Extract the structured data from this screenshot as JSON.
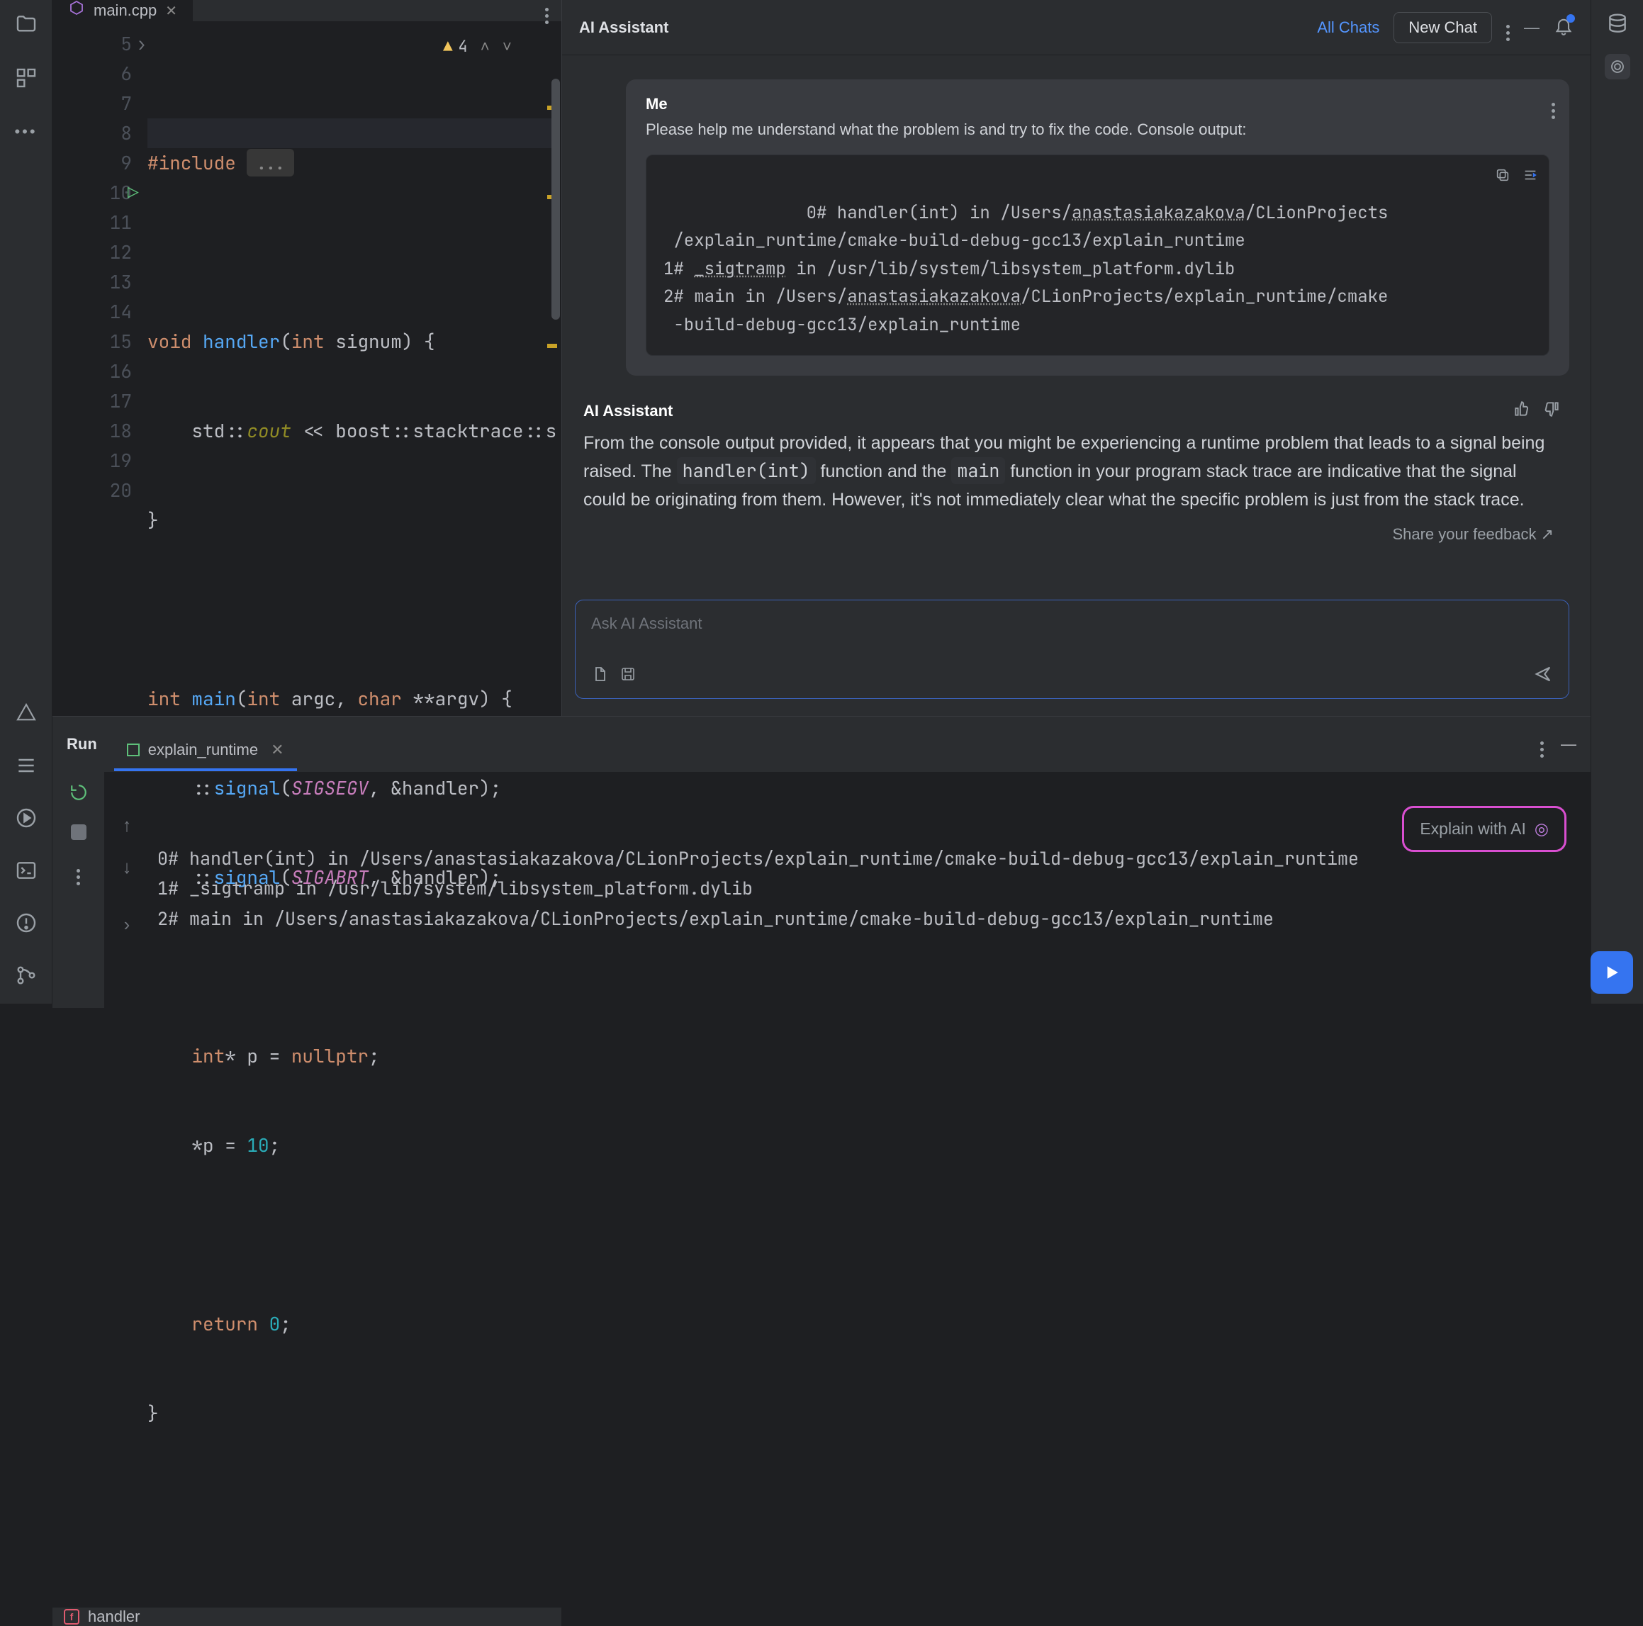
{
  "tab": {
    "file": "main.cpp"
  },
  "warnings": {
    "count": "4"
  },
  "code": {
    "l5_a": "#include",
    "l5_b": "...",
    "l7_a": "void ",
    "l7_b": "handler",
    "l7_c": "(",
    "l7_d": "int",
    "l7_e": " signum",
    "l7_f": ") {",
    "l8_a": "    std::",
    "l8_b": "cout",
    "l8_c": " << boost::stacktrace::s",
    "l9": "}",
    "l11_a": "int ",
    "l11_b": "main",
    "l11_c": "(",
    "l11_d": "int",
    "l11_e": " argc",
    "l11_f": ", ",
    "l11_g": "char",
    "l11_h": " **argv",
    "l11_i": ") {",
    "l12_a": "    ::",
    "l12_b": "signal",
    "l12_c": "(",
    "l12_d": "SIGSEGV",
    "l12_e": ", &handler);",
    "l13_a": "    ::",
    "l13_b": "signal",
    "l13_c": "(",
    "l13_d": "SIGABRT",
    "l13_e": ", &handler);",
    "l15_a": "    ",
    "l15_b": "int",
    "l15_c": "* p = ",
    "l15_d": "nullptr",
    "l15_e": ";",
    "l16_a": "    *p = ",
    "l16_b": "10",
    "l16_c": ";",
    "l18_a": "    ",
    "l18_b": "return ",
    "l18_c": "0",
    "l18_d": ";",
    "l19": "}"
  },
  "line_numbers": [
    "5",
    "6",
    "7",
    "8",
    "9",
    "10",
    "11",
    "12",
    "13",
    "14",
    "15",
    "16",
    "17",
    "18",
    "19",
    "20"
  ],
  "breadcrumb": {
    "symbol": "handler"
  },
  "ai": {
    "title": "AI Assistant",
    "all_chats": "All Chats",
    "new_chat": "New Chat",
    "me_label": "Me",
    "me_text": "Please help me understand what the problem is and try to fix the code. Console output:",
    "trace_l1a": "0# handler(int) in /Users/",
    "trace_l1b": "anastasiakazakova",
    "trace_l1c": "/CLionProjects",
    "trace_l2": " /explain_runtime/cmake-build-debug-gcc13/explain_runtime",
    "trace_l3a": "1# ",
    "trace_l3b": "_sigtramp",
    "trace_l3c": " in /usr/lib/system/libsystem_platform.dylib",
    "trace_l4a": "2# main in /Users/",
    "trace_l4b": "anastasiakazakova",
    "trace_l4c": "/CLionProjects/explain_runtime/cmake",
    "trace_l5": " -build-debug-gcc13/explain_runtime",
    "assistant_label": "AI Assistant",
    "assistant_p1a": "From the console output provided, it appears that you might be experiencing a runtime problem that leads to a signal being raised. The ",
    "assistant_p1b": "handler(int)",
    "assistant_p1c": " function and the ",
    "assistant_p1d": "main",
    "assistant_p1e": " function in your program stack trace are indicative that the signal could be originating from them. However, it's not immediately clear what the specific problem is just from the stack trace.",
    "feedback": "Share your feedback ↗",
    "placeholder": "Ask AI Assistant"
  },
  "run": {
    "label": "Run",
    "config": "explain_runtime",
    "console_l1": "0# handler(int) in /Users/anastasiakazakova/CLionProjects/explain_runtime/cmake-build-debug-gcc13/explain_runtime",
    "console_l2": "1# _sigtramp in /usr/lib/system/libsystem_platform.dylib",
    "console_l3": "2# main in /Users/anastasiakazakova/CLionProjects/explain_runtime/cmake-build-debug-gcc13/explain_runtime",
    "explain_label": "Explain with AI"
  }
}
